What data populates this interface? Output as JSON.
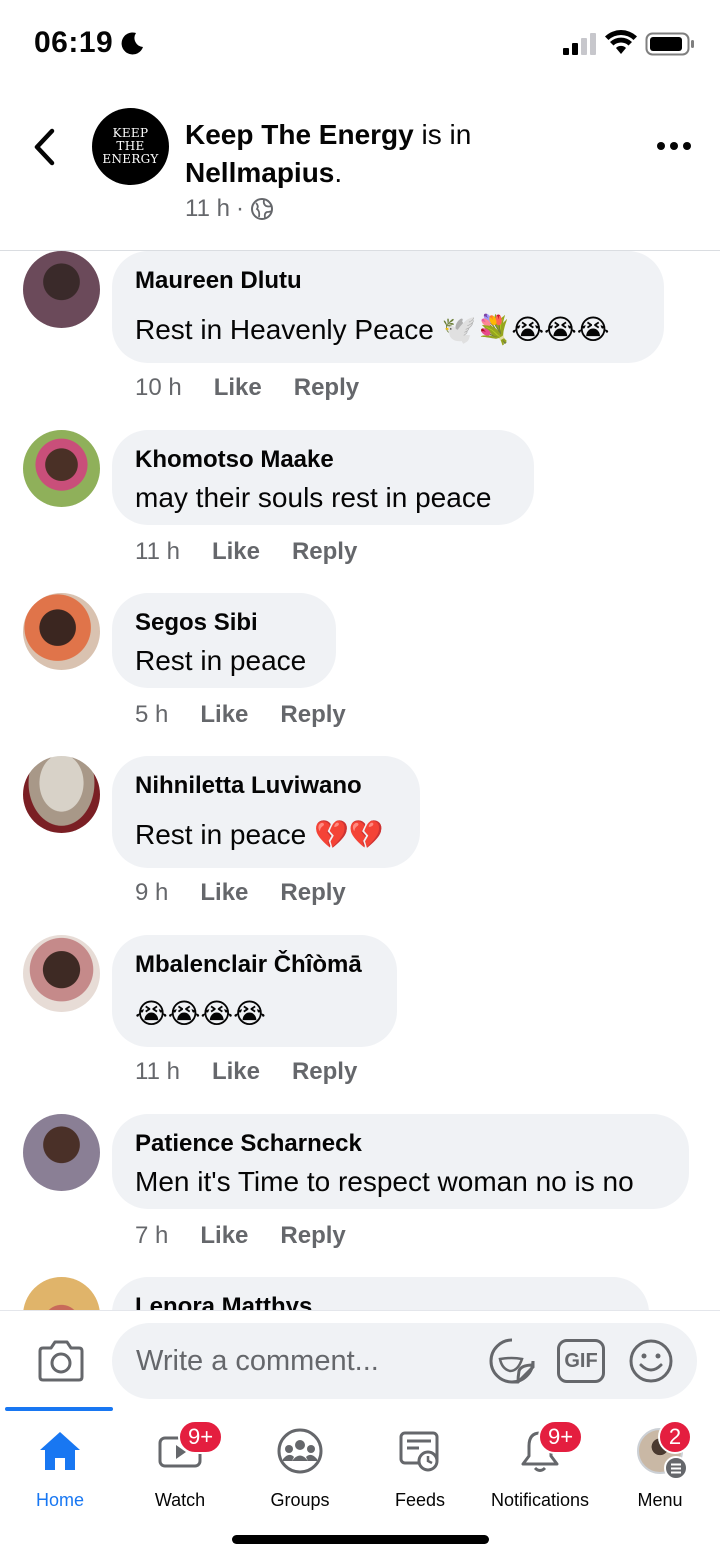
{
  "status_bar": {
    "time": "06:19"
  },
  "header": {
    "page_logo_lines": [
      "KEEP",
      "THE",
      "ENERGY"
    ],
    "page_name": "Keep The Energy",
    "is_in": " is in ",
    "location": "Nellmapius",
    "period": ".",
    "post_time": "11 h",
    "dot": "·"
  },
  "comments": [
    {
      "author": "Maureen Dlutu",
      "text": "Rest in Heavenly Peace",
      "emoji": "🕊️💐😭😭😭",
      "time": "10 h",
      "like": "Like",
      "reply": "Reply",
      "avatar_color": "#6b4a5a"
    },
    {
      "author": "Khomotso Maake",
      "text": "may their souls rest in peace",
      "emoji": "",
      "time": "11 h",
      "like": "Like",
      "reply": "Reply",
      "avatar_color": "#8fb05a"
    },
    {
      "author": "Segos Sibi",
      "text": "Rest in peace",
      "emoji": "",
      "time": "5 h",
      "like": "Like",
      "reply": "Reply",
      "avatar_color": "#d27f4f"
    },
    {
      "author": "Nihniletta Luviwano",
      "text": "Rest in peace",
      "emoji": "💔💔",
      "time": "9 h",
      "like": "Like",
      "reply": "Reply",
      "avatar_color": "#9b8a7a"
    },
    {
      "author": "Mbalenclair Čhîòmā",
      "text": "",
      "emoji": "😭😭😭😭",
      "time": "11 h",
      "like": "Like",
      "reply": "Reply",
      "avatar_color": "#5c4a44"
    },
    {
      "author": "Patience Scharneck",
      "text": "Men it's Time to respect woman no is no",
      "emoji": "",
      "time": "7 h",
      "like": "Like",
      "reply": "Reply",
      "avatar_color": "#7a6c78"
    },
    {
      "author": "Lenora Matthys",
      "text": "",
      "emoji": "",
      "time": "",
      "like": "",
      "reply": "",
      "avatar_color": "#e0b46a"
    }
  ],
  "composer": {
    "placeholder": "Write a comment...",
    "gif_label": "GIF"
  },
  "nav": {
    "home": "Home",
    "watch": "Watch",
    "watch_badge": "9+",
    "groups": "Groups",
    "feeds": "Feeds",
    "notifications": "Notifications",
    "notifications_badge": "9+",
    "menu": "Menu",
    "menu_badge": "2"
  },
  "colors": {
    "accent": "#1877f2",
    "badge": "#e41e3f",
    "bubble": "#f0f2f5",
    "secondary_text": "#65676b"
  }
}
